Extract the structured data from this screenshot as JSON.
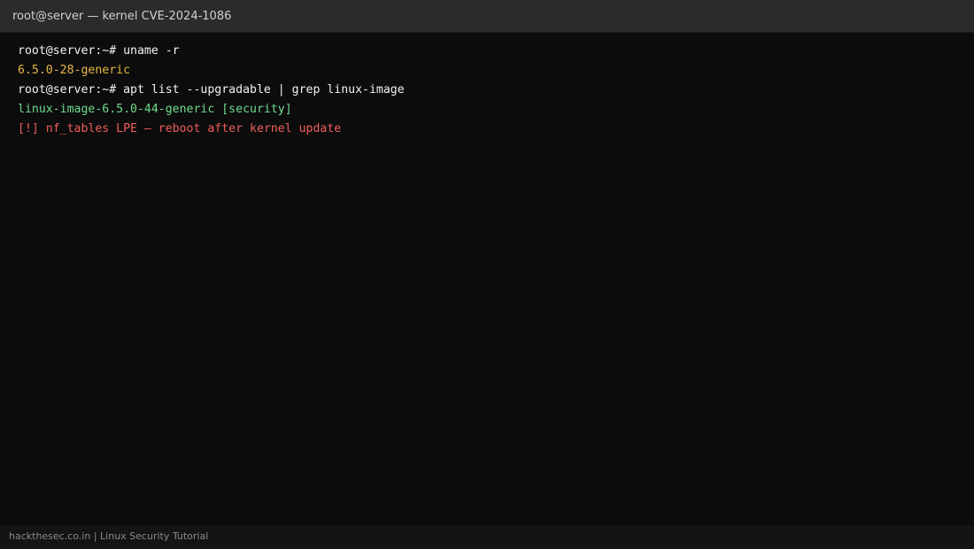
{
  "window": {
    "title": "root@server — kernel CVE-2024-1086"
  },
  "terminal": {
    "lines": [
      {
        "prompt": "root@server:~# ",
        "command": "uname -r"
      },
      {
        "output": "6.5.0-28-generic",
        "color": "#e5b94a"
      },
      {
        "prompt": "root@server:~# ",
        "command": "apt list --upgradable | grep linux-image"
      },
      {
        "output": "linux-image-6.5.0-44-generic [security]",
        "color": "#6fdc8c"
      },
      {
        "output": "[!] nf_tables LPE — reboot after kernel update",
        "color": "#f25c5c"
      }
    ]
  },
  "footer": {
    "text": "hackthesec.co.in | Linux Security Tutorial"
  },
  "colors": {
    "background": "#0c0c0c",
    "titlebar": "#2b2b2b",
    "footer": "#141414"
  }
}
